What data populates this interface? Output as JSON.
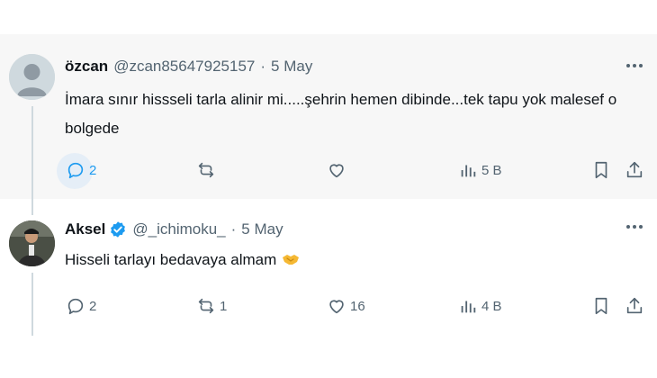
{
  "tweets": [
    {
      "name": "özcan",
      "handle": "@zcan85647925157",
      "separator": "·",
      "date": "5 May",
      "text": "İmara sınır hissseli tarla alinir mi.....şehrin hemen dibinde...tek tapu yok malesef o bolgede",
      "replies": "2",
      "reposts": "",
      "likes": "",
      "views": "5 B",
      "verified": false
    },
    {
      "name": "Aksel",
      "handle": "@_ichimoku_",
      "separator": "·",
      "date": "5 May",
      "text": "Hisseli tarlayı bedavaya almam",
      "emoji": "handshake-emoji",
      "replies": "2",
      "reposts": "1",
      "likes": "16",
      "views": "4 B",
      "verified": true
    }
  ],
  "colors": {
    "muted": "#536471",
    "verified": "#1d9bf0",
    "reply_active": "#1d9bf0",
    "thread_line": "#cfd9de"
  }
}
